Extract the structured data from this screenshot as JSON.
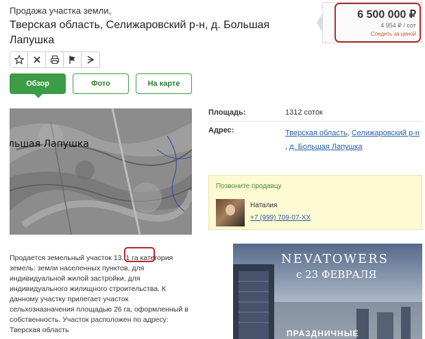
{
  "header": {
    "subtitle": "Продажа участка земли,",
    "title": "Тверская область, Селижаровский р-н, д. Большая Лапушка"
  },
  "price": {
    "main": "6 500 000 ₽",
    "per_unit": "4 954 ₽ / сот",
    "follow_link": "Следить за ценой"
  },
  "toolbar": {
    "favorite_icon": "star-icon",
    "hide_icon": "close-icon",
    "print_icon": "print-icon",
    "report_icon": "flag-icon",
    "share_icon": "share-icon"
  },
  "tabs": [
    {
      "label": "Обзор",
      "active": true
    },
    {
      "label": "Фото",
      "active": false
    },
    {
      "label": "На карте",
      "active": false
    }
  ],
  "map": {
    "label": "льшая Лапушка"
  },
  "properties": {
    "area_label": "Площадь:",
    "area_value": "1312 соток",
    "address_label": "Адрес:",
    "address_region": "Тверская область",
    "address_district": "Селижаровский р-н",
    "address_village": "д. Большая Лапушка"
  },
  "seller": {
    "call_prompt": "Позвоните продавцу",
    "name": "Наталия",
    "phone": "+7 (999) 709-07-XX"
  },
  "description": {
    "text": "Продается земельный участок 13, 1 га категория земель: земли населенных пунктов, для индивидуальной жилой застройки, для индивидуального жилищного строительства. К данному участку прилегает участок сельхозназначения площадью 26 га, оформленный в собственность. Участок расположен по адресу: Тверская область"
  },
  "ad": {
    "brand": "NEVATOWERS",
    "date": "с 23 ФЕВРАЛЯ",
    "bottom": "ПРАЗДНИЧНЫЕ"
  },
  "colors": {
    "accent_green": "#3d9c47",
    "highlight_red": "#b22a2a",
    "link_blue": "#2b5ea8"
  }
}
